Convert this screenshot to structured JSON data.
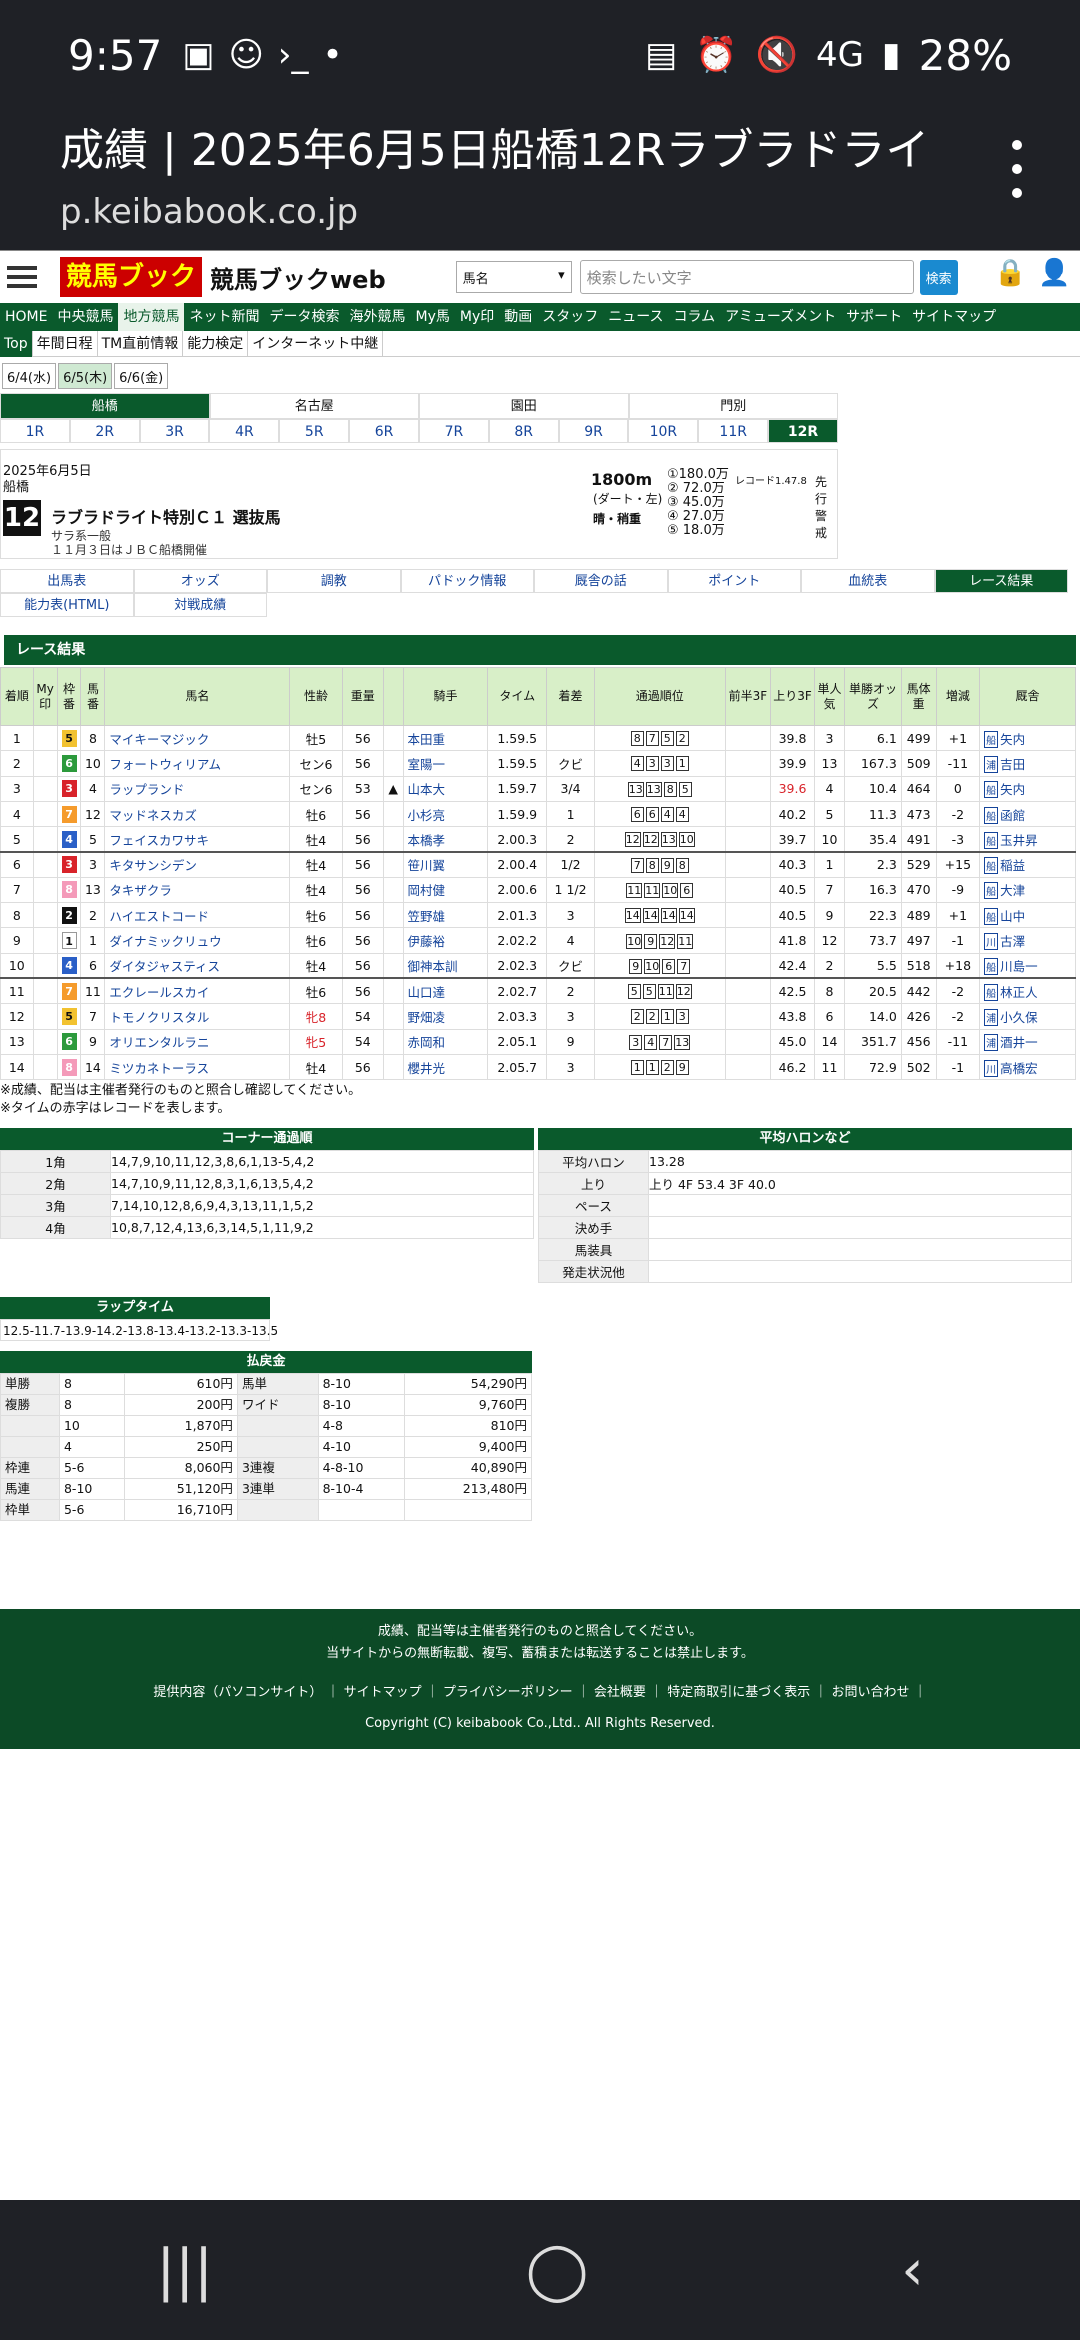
{
  "status": {
    "time": "9:57",
    "icons_left": [
      "▣",
      "☺",
      "›_",
      "•"
    ],
    "icons_right": [
      "▤",
      "⏰",
      "🔇",
      "4G",
      "▮",
      "28%"
    ]
  },
  "appbar": {
    "title": "成績 | 2025年6月5日船橋12Rラブラドライト...",
    "url": "p.keibabook.co.jp"
  },
  "header": {
    "logo": "競馬ブック",
    "site": "競馬ブックweb",
    "select": "馬名",
    "search_placeholder": "検索したい文字",
    "search_btn": "検索"
  },
  "gnav": [
    "HOME",
    "中央競馬",
    "地方競馬",
    "ネット新聞",
    "データ検索",
    "海外競馬",
    "My馬",
    "My印",
    "動画",
    "スタッフ",
    "ニュース",
    "コラム",
    "アミューズメント",
    "サポート",
    "サイトマップ"
  ],
  "snav": [
    "Top",
    "年間日程",
    "TM直前情報",
    "能力検定",
    "インターネット中継"
  ],
  "dates": [
    "6/4(水)",
    "6/5(木)",
    "6/6(金)"
  ],
  "venues": [
    "船橋",
    "名古屋",
    "園田",
    "門別"
  ],
  "races": [
    "1R",
    "2R",
    "3R",
    "4R",
    "5R",
    "6R",
    "7R",
    "8R",
    "9R",
    "10R",
    "11R",
    "12R"
  ],
  "race": {
    "date": "2025年6月5日",
    "venue": "船橋",
    "num": "12",
    "name": "ラブラドライト特別Ｃ１ 選抜馬",
    "class": "サラ系一般",
    "cond": "１１月３日はＪＢＣ船橋開催",
    "dist": "1800m",
    "surface": "(ダート・左)",
    "weather": "晴・稍重",
    "prizes": [
      "①180.0万",
      "② 72.0万",
      "③ 45.0万",
      "④ 27.0万",
      "⑤ 18.0万"
    ],
    "record": "レコード1.47.8",
    "style": "先行警戒"
  },
  "tabs": [
    "出馬表",
    "オッズ",
    "調教",
    "パドック情報",
    "厩舎の話",
    "ポイント",
    "血統表",
    "レース結果",
    "能力表(HTML)",
    "対戦成績"
  ],
  "results_title": "レース結果",
  "headers": [
    "着順",
    "My印",
    "枠番",
    "馬番",
    "馬名",
    "性齢",
    "重量",
    "",
    "騎手",
    "タイム",
    "着差",
    "通過順位",
    "前半3F",
    "上り3F",
    "単人気",
    "単勝オッズ",
    "馬体重",
    "増減",
    "厩舎"
  ],
  "rows": [
    [
      "1",
      "",
      "5",
      "8",
      "マイキーマジック",
      "牡5",
      "56",
      "",
      "本田重",
      "1.59.5",
      "",
      "8-7-5-2",
      "",
      "39.8",
      "3",
      "6.1",
      "499",
      "+1",
      "船",
      "矢内"
    ],
    [
      "2",
      "",
      "6",
      "10",
      "フォートウィリアム",
      "セン6",
      "56",
      "",
      "室陽一",
      "1.59.5",
      "クビ",
      "4-3-3-1",
      "",
      "39.9",
      "13",
      "167.3",
      "509",
      "-11",
      "浦",
      "吉田"
    ],
    [
      "3",
      "",
      "3",
      "4",
      "ラップランド",
      "セン6",
      "53",
      "▲",
      "山本大",
      "1.59.7",
      "3/4",
      "13-13-8-5",
      "",
      "39.6",
      "4",
      "10.4",
      "464",
      "0",
      "船",
      "矢内"
    ],
    [
      "4",
      "",
      "7",
      "12",
      "マッドネスカズ",
      "牡6",
      "56",
      "",
      "小杉亮",
      "1.59.9",
      "1",
      "6-6-4-4",
      "",
      "40.2",
      "5",
      "11.3",
      "473",
      "-2",
      "船",
      "函館"
    ],
    [
      "5",
      "",
      "4",
      "5",
      "フェイスカワサキ",
      "牡4",
      "56",
      "",
      "本橋孝",
      "2.00.3",
      "2",
      "12-12-13-10",
      "",
      "39.7",
      "10",
      "35.4",
      "491",
      "-3",
      "船",
      "玉井昇"
    ],
    [
      "6",
      "",
      "3",
      "3",
      "キタサンシデン",
      "牡4",
      "56",
      "",
      "笹川翼",
      "2.00.4",
      "1/2",
      "7-8-9-8",
      "",
      "40.3",
      "1",
      "2.3",
      "529",
      "+15",
      "船",
      "稲益"
    ],
    [
      "7",
      "",
      "8",
      "13",
      "タキザクラ",
      "牡4",
      "56",
      "",
      "岡村健",
      "2.00.6",
      "1 1/2",
      "11-11-10-6",
      "",
      "40.5",
      "7",
      "16.3",
      "470",
      "-9",
      "船",
      "大津"
    ],
    [
      "8",
      "",
      "2",
      "2",
      "ハイエストコード",
      "牡6",
      "56",
      "",
      "笠野雄",
      "2.01.3",
      "3",
      "14-14-14-14",
      "",
      "40.5",
      "9",
      "22.3",
      "489",
      "+1",
      "船",
      "山中"
    ],
    [
      "9",
      "",
      "1",
      "1",
      "ダイナミックリュウ",
      "牡6",
      "56",
      "",
      "伊藤裕",
      "2.02.2",
      "4",
      "10-9-12-11",
      "",
      "41.8",
      "12",
      "73.7",
      "497",
      "-1",
      "川",
      "古澤"
    ],
    [
      "10",
      "",
      "4",
      "6",
      "ダイタジャスティス",
      "牡4",
      "56",
      "",
      "御神本訓",
      "2.02.3",
      "クビ",
      "9-10-6-7",
      "",
      "42.4",
      "2",
      "5.5",
      "518",
      "+18",
      "船",
      "川島一"
    ],
    [
      "11",
      "",
      "7",
      "11",
      "エクレールスカイ",
      "牡6",
      "56",
      "",
      "山口達",
      "2.02.7",
      "2",
      "5-5-11-12",
      "",
      "42.5",
      "8",
      "20.5",
      "442",
      "-2",
      "船",
      "林正人"
    ],
    [
      "12",
      "",
      "5",
      "7",
      "トモノクリスタル",
      "牝8",
      "54",
      "",
      "野畑凌",
      "2.03.3",
      "3",
      "2-2-1-3",
      "",
      "43.8",
      "6",
      "14.0",
      "426",
      "-2",
      "浦",
      "小久保"
    ],
    [
      "13",
      "",
      "6",
      "9",
      "オリエンタルラニ",
      "牝5",
      "54",
      "",
      "赤岡和",
      "2.05.1",
      "9",
      "3-4-7-13",
      "",
      "45.0",
      "14",
      "351.7",
      "456",
      "-11",
      "浦",
      "酒井一"
    ],
    [
      "14",
      "",
      "8",
      "14",
      "ミツカネトーラス",
      "牡4",
      "56",
      "",
      "櫻井光",
      "2.05.7",
      "3",
      "1-1-2-9",
      "",
      "46.2",
      "11",
      "72.9",
      "502",
      "-1",
      "川",
      "高橋宏"
    ]
  ],
  "notes": [
    "※成績、配当は主催者発行のものと照合し確認してください。",
    "※タイムの赤字はレコードを表します。"
  ],
  "corner": {
    "title": "コーナー通過順",
    "rows": [
      [
        "1角",
        "14,7,9,10,11,12,3,8,6,1,13-5,4,2"
      ],
      [
        "2角",
        "14,7,10,9,11,12,8,3,1,6,13,5,4,2"
      ],
      [
        "3角",
        "7,14,10,12,8,6,9,4,3,13,11,1,5,2"
      ],
      [
        "4角",
        "10,8,7,12,4,13,6,3,14,5,1,11,9,2"
      ]
    ]
  },
  "avg": {
    "title": "平均ハロンなど",
    "rows": [
      [
        "平均ハロン",
        "13.28"
      ],
      [
        "上り",
        "上り 4F 53.4 3F 40.0"
      ],
      [
        "ペース",
        ""
      ],
      [
        "決め手",
        ""
      ],
      [
        "馬装具",
        ""
      ],
      [
        "発走状況他",
        ""
      ]
    ]
  },
  "lap": {
    "title": "ラップタイム",
    "value": "12.5-11.7-13.9-14.2-13.8-13.4-13.2-13.3-13.5"
  },
  "pay": {
    "title": "払戻金",
    "rows": [
      [
        "単勝",
        "8",
        "610円",
        "馬単",
        "8-10",
        "54,290円"
      ],
      [
        "複勝",
        "8",
        "200円",
        "ワイド",
        "8-10",
        "9,760円"
      ],
      [
        "",
        "10",
        "1,870円",
        "",
        "4-8",
        "810円"
      ],
      [
        "",
        "4",
        "250円",
        "",
        "4-10",
        "9,400円"
      ],
      [
        "枠連",
        "5-6",
        "8,060円",
        "3連複",
        "4-8-10",
        "40,890円"
      ],
      [
        "馬連",
        "8-10",
        "51,120円",
        "3連単",
        "8-10-4",
        "213,480円"
      ],
      [
        "枠単",
        "5-6",
        "16,710円",
        "",
        "",
        ""
      ]
    ]
  },
  "footer": {
    "l1": "成績、配当等は主催者発行のものと照合してください。",
    "l2": "当サイトからの無断転載、複写、蓄積または転送することは禁止します。",
    "links": "提供内容（パソコンサイト） ｜ サイトマップ ｜ プライバシーポリシー ｜ 会社概要 ｜ 特定商取引に基づく表示 ｜ お問い合わせ ｜",
    "copy": "Copyright (C) keibabook Co.,Ltd.. All Rights Reserved."
  },
  "navbar": {
    "recents": "|||",
    "home": "◯",
    "back": "‹"
  },
  "colors": {
    "green": "#0a5a2c",
    "waku": [
      "#ffffff",
      "#111111",
      "#d8232a",
      "#2a5fc7",
      "#f2c230",
      "#2c9a3c",
      "#f59b2c",
      "#f49ab9"
    ]
  }
}
